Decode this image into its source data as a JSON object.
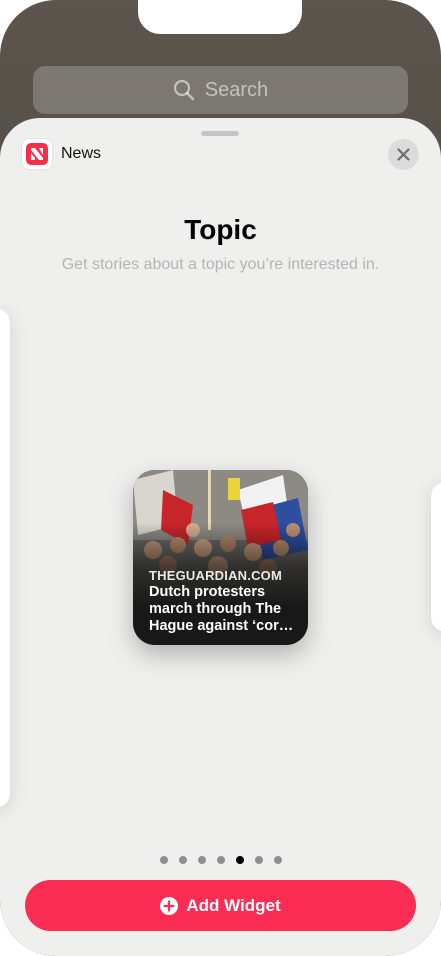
{
  "search": {
    "placeholder": "Search",
    "icon": "search-icon"
  },
  "app": {
    "name": "News",
    "icon": "apple-news-icon",
    "accent": "#fa2d48"
  },
  "sheet": {
    "title": "Topic",
    "subtitle": "Get stories about a topic you’re interested in."
  },
  "widget": {
    "source": "THEGUARDIAN.COM",
    "headline": "Dutch protesters march through The Hague against ‘cor…"
  },
  "pager": {
    "count": 7,
    "active_index": 4
  },
  "add_button": {
    "label": "Add Widget",
    "icon": "plus-circle-icon",
    "color": "#fc2d55"
  },
  "close": {
    "icon": "close-icon"
  }
}
